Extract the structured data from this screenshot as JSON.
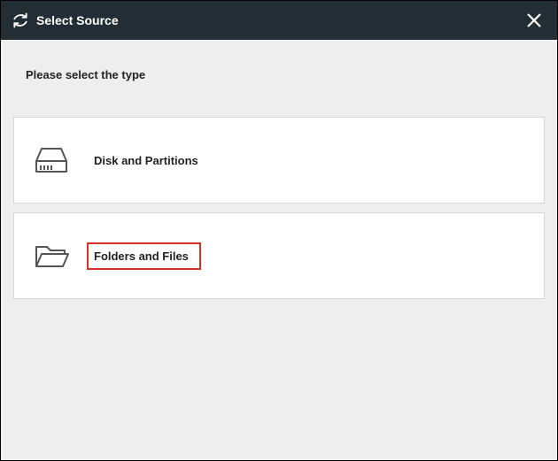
{
  "titlebar": {
    "title": "Select Source"
  },
  "content": {
    "prompt": "Please select the type",
    "options": [
      {
        "label": "Disk and Partitions"
      },
      {
        "label": "Folders and Files"
      }
    ]
  }
}
